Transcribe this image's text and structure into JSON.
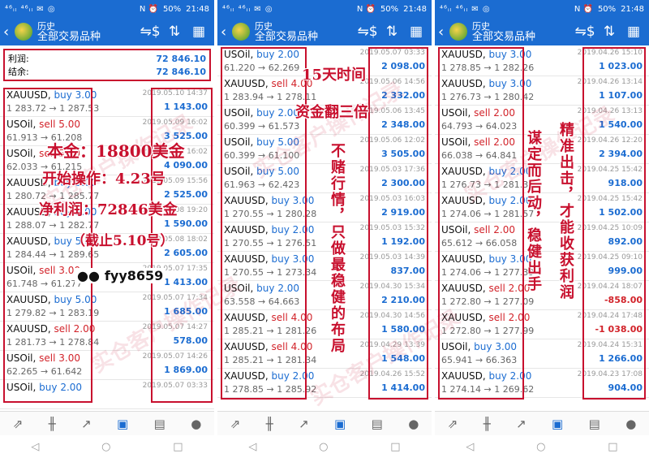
{
  "status": {
    "signal": "⁴⁶ᵢₗ ⁴⁶ᵢₗ ✉ ◎",
    "right_icons": "N ⏰",
    "battery": "50%",
    "time": "21:48"
  },
  "header": {
    "title": "历史",
    "subtitle": "全部交易品种"
  },
  "summary": {
    "profit_label": "利润:",
    "profit_value": "72 846.10",
    "balance_label": "结余:",
    "balance_value": "72 846.10"
  },
  "panels": [
    {
      "trades": [
        {
          "symbol": "XAUUSD",
          "side": "buy",
          "lot": "3.00",
          "open": "1 283.72",
          "close": "1 287.53",
          "date": "2019.05.10 14:37",
          "profit": "1 143.00"
        },
        {
          "symbol": "USOil",
          "side": "sell",
          "lot": "5.00",
          "open": "61.913",
          "close": "61.208",
          "date": "2019.05.09 16:02",
          "profit": "3 525.00"
        },
        {
          "symbol": "USOil",
          "side": "sell",
          "lot": "5.00",
          "open": "62.033",
          "close": "61.215",
          "date": "2019.05.09 16:02",
          "profit": "4 090.00"
        },
        {
          "symbol": "XAUUSD",
          "side": "buy",
          "lot": "5.00",
          "open": "1 280.72",
          "close": "1 285.77",
          "date": "2019.05.09 15:56",
          "profit": "2 525.00"
        },
        {
          "symbol": "XAUUSD",
          "side": "buy",
          "lot": "3.00",
          "open": "1 288.07",
          "close": "1 282.77",
          "date": "2019.05.08 19:20",
          "profit": "1 590.00"
        },
        {
          "symbol": "XAUUSD",
          "side": "buy",
          "lot": "5.00",
          "open": "1 284.44",
          "close": "1 289.65",
          "date": "2019.05.08 18:02",
          "profit": "2 605.00"
        },
        {
          "symbol": "USOil",
          "side": "sell",
          "lot": "3.00",
          "open": "61.748",
          "close": "61.277",
          "date": "2019.05.07 17:35",
          "profit": "1 413.00"
        },
        {
          "symbol": "XAUUSD",
          "side": "buy",
          "lot": "5.00",
          "open": "1 279.82",
          "close": "1 283.19",
          "date": "2019.05.07 17:34",
          "profit": "1 685.00"
        },
        {
          "symbol": "XAUUSD",
          "side": "sell",
          "lot": "2.00",
          "open": "1 281.73",
          "close": "1 278.84",
          "date": "2019.05.07 14:27",
          "profit": "578.00"
        },
        {
          "symbol": "USOil",
          "side": "sell",
          "lot": "3.00",
          "open": "62.265",
          "close": "61.642",
          "date": "2019.05.07 14:26",
          "profit": "1 869.00"
        },
        {
          "symbol": "USOil",
          "side": "buy",
          "lot": "2.00",
          "open": "",
          "close": "",
          "date": "2019.05.07 03:33",
          "profit": ""
        }
      ]
    },
    {
      "trades": [
        {
          "symbol": "USOil",
          "side": "buy",
          "lot": "2.00",
          "open": "61.220",
          "close": "62.269",
          "date": "2019.05.07 03:33",
          "profit": "2 098.00"
        },
        {
          "symbol": "XAUUSD",
          "side": "sell",
          "lot": "4.00",
          "open": "1 283.94",
          "close": "1 278.11",
          "date": "2019.05.06 14:56",
          "profit": "2 332.00"
        },
        {
          "symbol": "USOil",
          "side": "buy",
          "lot": "2.00",
          "open": "60.399",
          "close": "61.573",
          "date": "2019.05.06 13:45",
          "profit": "2 348.00"
        },
        {
          "symbol": "USOil",
          "side": "buy",
          "lot": "5.00",
          "open": "60.399",
          "close": "61.100",
          "date": "2019.05.06 12:02",
          "profit": "3 505.00"
        },
        {
          "symbol": "USOil",
          "side": "buy",
          "lot": "5.00",
          "open": "61.963",
          "close": "62.423",
          "date": "2019.05.03 17:36",
          "profit": "2 300.00"
        },
        {
          "symbol": "XAUUSD",
          "side": "buy",
          "lot": "3.00",
          "open": "1 270.55",
          "close": "1 280.28",
          "date": "2019.05.03 16:03",
          "profit": "2 919.00"
        },
        {
          "symbol": "XAUUSD",
          "side": "buy",
          "lot": "2.00",
          "open": "1 270.55",
          "close": "1 276.51",
          "date": "2019.05.03 15:32",
          "profit": "1 192.00"
        },
        {
          "symbol": "XAUUSD",
          "side": "buy",
          "lot": "3.00",
          "open": "1 270.55",
          "close": "1 273.34",
          "date": "2019.05.03 14:39",
          "profit": "837.00"
        },
        {
          "symbol": "USOil",
          "side": "buy",
          "lot": "2.00",
          "open": "63.558",
          "close": "64.663",
          "date": "2019.04.30 15:34",
          "profit": "2 210.00"
        },
        {
          "symbol": "XAUUSD",
          "side": "sell",
          "lot": "4.00",
          "open": "1 285.21",
          "close": "1 281.26",
          "date": "2019.04.30 14:56",
          "profit": "1 580.00"
        },
        {
          "symbol": "XAUUSD",
          "side": "sell",
          "lot": "4.00",
          "open": "1 285.21",
          "close": "1 281.34",
          "date": "2019.04.29 13:39",
          "profit": "1 548.00"
        },
        {
          "symbol": "XAUUSD",
          "side": "buy",
          "lot": "2.00",
          "open": "1 278.85",
          "close": "1 285.92",
          "date": "2019.04.26 15:52",
          "profit": "1 414.00"
        }
      ]
    },
    {
      "trades": [
        {
          "symbol": "XAUUSD",
          "side": "buy",
          "lot": "3.00",
          "open": "1 278.85",
          "close": "1 282.26",
          "date": "2019.04.26 15:10",
          "profit": "1 023.00"
        },
        {
          "symbol": "XAUUSD",
          "side": "buy",
          "lot": "3.00",
          "open": "1 276.73",
          "close": "1 280.42",
          "date": "2019.04.26 13:14",
          "profit": "1 107.00"
        },
        {
          "symbol": "USOil",
          "side": "sell",
          "lot": "2.00",
          "open": "64.793",
          "close": "64.023",
          "date": "2019.04.26 13:13",
          "profit": "1 540.00"
        },
        {
          "symbol": "USOil",
          "side": "sell",
          "lot": "2.00",
          "open": "66.038",
          "close": "64.841",
          "date": "2019.04.26 12:20",
          "profit": "2 394.00"
        },
        {
          "symbol": "XAUUSD",
          "side": "buy",
          "lot": "2.00",
          "open": "1 276.73",
          "close": "1 281.32",
          "date": "2019.04.25 15:42",
          "profit": "918.00"
        },
        {
          "symbol": "XAUUSD",
          "side": "buy",
          "lot": "2.00",
          "open": "1 274.06",
          "close": "1 281.57",
          "date": "2019.04.25 15:42",
          "profit": "1 502.00"
        },
        {
          "symbol": "USOil",
          "side": "sell",
          "lot": "2.00",
          "open": "65.612",
          "close": "66.058",
          "date": "2019.04.25 10:09",
          "profit": "892.00"
        },
        {
          "symbol": "XAUUSD",
          "side": "buy",
          "lot": "3.00",
          "open": "1 274.06",
          "close": "1 277.39",
          "date": "2019.04.25 09:10",
          "profit": "999.00"
        },
        {
          "symbol": "XAUUSD",
          "side": "sell",
          "lot": "2.00",
          "open": "1 272.80",
          "close": "1 277.09",
          "date": "2019.04.24 18:07",
          "profit": "-858.00"
        },
        {
          "symbol": "XAUUSD",
          "side": "sell",
          "lot": "2.00",
          "open": "1 272.80",
          "close": "1 277.99",
          "date": "2019.04.24 17:48",
          "profit": "-1 038.00"
        },
        {
          "symbol": "USOil",
          "side": "buy",
          "lot": "3.00",
          "open": "65.941",
          "close": "66.363",
          "date": "2019.04.24 15:31",
          "profit": "1 266.00"
        },
        {
          "symbol": "XAUUSD",
          "side": "buy",
          "lot": "2.00",
          "open": "1 274.14",
          "close": "1 269.62",
          "date": "2019.04.23 17:08",
          "profit": "904.00"
        }
      ]
    }
  ],
  "annotations": {
    "capital": "本金：18800美金",
    "start": "开始操作：4.23号",
    "net_profit": "净利润：72846美金",
    "cutoff": "（截止5.10号）",
    "wechat_id": "fyy8659",
    "fifteen_days": "15天时间",
    "tripled": "资金翻三倍",
    "no_gamble": "不赌行情，只做最稳健的布局",
    "steady": "谋定而后动，稳健出手",
    "precise": "精准出击，才能收获利润",
    "watermark": "实仓客户操作记录"
  },
  "colors": {
    "header_blue": "#1b6cd1",
    "sell_red": "#d2232a",
    "annotation_red": "#c8102e"
  }
}
